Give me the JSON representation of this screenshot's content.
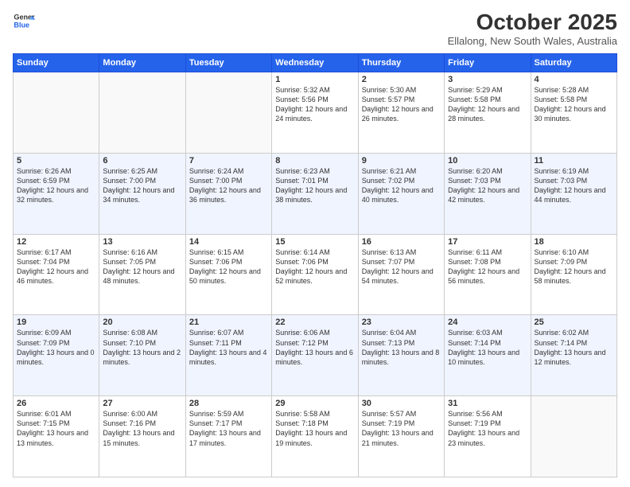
{
  "logo": {
    "line1": "General",
    "line2": "Blue"
  },
  "header": {
    "month": "October 2025",
    "location": "Ellalong, New South Wales, Australia"
  },
  "weekdays": [
    "Sunday",
    "Monday",
    "Tuesday",
    "Wednesday",
    "Thursday",
    "Friday",
    "Saturday"
  ],
  "weeks": [
    [
      {
        "day": "",
        "sunrise": "",
        "sunset": "",
        "daylight": ""
      },
      {
        "day": "",
        "sunrise": "",
        "sunset": "",
        "daylight": ""
      },
      {
        "day": "",
        "sunrise": "",
        "sunset": "",
        "daylight": ""
      },
      {
        "day": "1",
        "sunrise": "Sunrise: 5:32 AM",
        "sunset": "Sunset: 5:56 PM",
        "daylight": "Daylight: 12 hours and 24 minutes."
      },
      {
        "day": "2",
        "sunrise": "Sunrise: 5:30 AM",
        "sunset": "Sunset: 5:57 PM",
        "daylight": "Daylight: 12 hours and 26 minutes."
      },
      {
        "day": "3",
        "sunrise": "Sunrise: 5:29 AM",
        "sunset": "Sunset: 5:58 PM",
        "daylight": "Daylight: 12 hours and 28 minutes."
      },
      {
        "day": "4",
        "sunrise": "Sunrise: 5:28 AM",
        "sunset": "Sunset: 5:58 PM",
        "daylight": "Daylight: 12 hours and 30 minutes."
      }
    ],
    [
      {
        "day": "5",
        "sunrise": "Sunrise: 6:26 AM",
        "sunset": "Sunset: 6:59 PM",
        "daylight": "Daylight: 12 hours and 32 minutes."
      },
      {
        "day": "6",
        "sunrise": "Sunrise: 6:25 AM",
        "sunset": "Sunset: 7:00 PM",
        "daylight": "Daylight: 12 hours and 34 minutes."
      },
      {
        "day": "7",
        "sunrise": "Sunrise: 6:24 AM",
        "sunset": "Sunset: 7:00 PM",
        "daylight": "Daylight: 12 hours and 36 minutes."
      },
      {
        "day": "8",
        "sunrise": "Sunrise: 6:23 AM",
        "sunset": "Sunset: 7:01 PM",
        "daylight": "Daylight: 12 hours and 38 minutes."
      },
      {
        "day": "9",
        "sunrise": "Sunrise: 6:21 AM",
        "sunset": "Sunset: 7:02 PM",
        "daylight": "Daylight: 12 hours and 40 minutes."
      },
      {
        "day": "10",
        "sunrise": "Sunrise: 6:20 AM",
        "sunset": "Sunset: 7:03 PM",
        "daylight": "Daylight: 12 hours and 42 minutes."
      },
      {
        "day": "11",
        "sunrise": "Sunrise: 6:19 AM",
        "sunset": "Sunset: 7:03 PM",
        "daylight": "Daylight: 12 hours and 44 minutes."
      }
    ],
    [
      {
        "day": "12",
        "sunrise": "Sunrise: 6:17 AM",
        "sunset": "Sunset: 7:04 PM",
        "daylight": "Daylight: 12 hours and 46 minutes."
      },
      {
        "day": "13",
        "sunrise": "Sunrise: 6:16 AM",
        "sunset": "Sunset: 7:05 PM",
        "daylight": "Daylight: 12 hours and 48 minutes."
      },
      {
        "day": "14",
        "sunrise": "Sunrise: 6:15 AM",
        "sunset": "Sunset: 7:06 PM",
        "daylight": "Daylight: 12 hours and 50 minutes."
      },
      {
        "day": "15",
        "sunrise": "Sunrise: 6:14 AM",
        "sunset": "Sunset: 7:06 PM",
        "daylight": "Daylight: 12 hours and 52 minutes."
      },
      {
        "day": "16",
        "sunrise": "Sunrise: 6:13 AM",
        "sunset": "Sunset: 7:07 PM",
        "daylight": "Daylight: 12 hours and 54 minutes."
      },
      {
        "day": "17",
        "sunrise": "Sunrise: 6:11 AM",
        "sunset": "Sunset: 7:08 PM",
        "daylight": "Daylight: 12 hours and 56 minutes."
      },
      {
        "day": "18",
        "sunrise": "Sunrise: 6:10 AM",
        "sunset": "Sunset: 7:09 PM",
        "daylight": "Daylight: 12 hours and 58 minutes."
      }
    ],
    [
      {
        "day": "19",
        "sunrise": "Sunrise: 6:09 AM",
        "sunset": "Sunset: 7:09 PM",
        "daylight": "Daylight: 13 hours and 0 minutes."
      },
      {
        "day": "20",
        "sunrise": "Sunrise: 6:08 AM",
        "sunset": "Sunset: 7:10 PM",
        "daylight": "Daylight: 13 hours and 2 minutes."
      },
      {
        "day": "21",
        "sunrise": "Sunrise: 6:07 AM",
        "sunset": "Sunset: 7:11 PM",
        "daylight": "Daylight: 13 hours and 4 minutes."
      },
      {
        "day": "22",
        "sunrise": "Sunrise: 6:06 AM",
        "sunset": "Sunset: 7:12 PM",
        "daylight": "Daylight: 13 hours and 6 minutes."
      },
      {
        "day": "23",
        "sunrise": "Sunrise: 6:04 AM",
        "sunset": "Sunset: 7:13 PM",
        "daylight": "Daylight: 13 hours and 8 minutes."
      },
      {
        "day": "24",
        "sunrise": "Sunrise: 6:03 AM",
        "sunset": "Sunset: 7:14 PM",
        "daylight": "Daylight: 13 hours and 10 minutes."
      },
      {
        "day": "25",
        "sunrise": "Sunrise: 6:02 AM",
        "sunset": "Sunset: 7:14 PM",
        "daylight": "Daylight: 13 hours and 12 minutes."
      }
    ],
    [
      {
        "day": "26",
        "sunrise": "Sunrise: 6:01 AM",
        "sunset": "Sunset: 7:15 PM",
        "daylight": "Daylight: 13 hours and 13 minutes."
      },
      {
        "day": "27",
        "sunrise": "Sunrise: 6:00 AM",
        "sunset": "Sunset: 7:16 PM",
        "daylight": "Daylight: 13 hours and 15 minutes."
      },
      {
        "day": "28",
        "sunrise": "Sunrise: 5:59 AM",
        "sunset": "Sunset: 7:17 PM",
        "daylight": "Daylight: 13 hours and 17 minutes."
      },
      {
        "day": "29",
        "sunrise": "Sunrise: 5:58 AM",
        "sunset": "Sunset: 7:18 PM",
        "daylight": "Daylight: 13 hours and 19 minutes."
      },
      {
        "day": "30",
        "sunrise": "Sunrise: 5:57 AM",
        "sunset": "Sunset: 7:19 PM",
        "daylight": "Daylight: 13 hours and 21 minutes."
      },
      {
        "day": "31",
        "sunrise": "Sunrise: 5:56 AM",
        "sunset": "Sunset: 7:19 PM",
        "daylight": "Daylight: 13 hours and 23 minutes."
      },
      {
        "day": "",
        "sunrise": "",
        "sunset": "",
        "daylight": ""
      }
    ]
  ]
}
